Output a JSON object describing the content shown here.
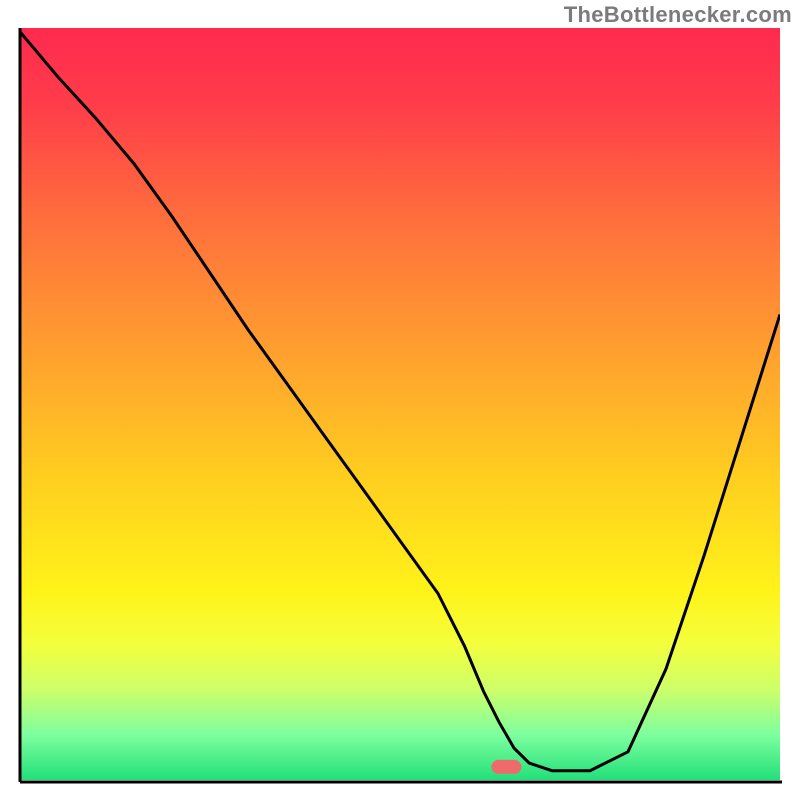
{
  "watermark": "TheBottlenecker.com",
  "chart_data": {
    "type": "line",
    "title": "",
    "xlabel": "",
    "ylabel": "",
    "xlim": [
      0,
      100
    ],
    "ylim": [
      0,
      100
    ],
    "x": [
      0,
      5,
      10,
      15,
      20,
      25,
      30,
      35,
      40,
      45,
      50,
      55,
      58.5,
      61,
      63,
      65,
      67,
      70,
      75,
      80,
      85,
      90,
      95,
      100
    ],
    "values": [
      99.5,
      93.5,
      88,
      82,
      75,
      67.5,
      60,
      53,
      46,
      39,
      32,
      25,
      18,
      12,
      8,
      4.5,
      2.5,
      1.5,
      1.5,
      4,
      15,
      30,
      46,
      62
    ],
    "marker": {
      "x": 64,
      "y": 2
    },
    "gradient_stops": [
      {
        "pos": 0,
        "color": "#ff2a4f"
      },
      {
        "pos": 10,
        "color": "#ff3c4a"
      },
      {
        "pos": 25,
        "color": "#ff6d3d"
      },
      {
        "pos": 45,
        "color": "#ffa52d"
      },
      {
        "pos": 60,
        "color": "#ffcf1f"
      },
      {
        "pos": 75,
        "color": "#fff31a"
      },
      {
        "pos": 82,
        "color": "#f3ff3d"
      },
      {
        "pos": 88,
        "color": "#cdff6a"
      },
      {
        "pos": 94,
        "color": "#7dff9f"
      },
      {
        "pos": 100,
        "color": "#22e07a"
      }
    ],
    "background_band": {
      "from": 75,
      "to": 100
    }
  }
}
